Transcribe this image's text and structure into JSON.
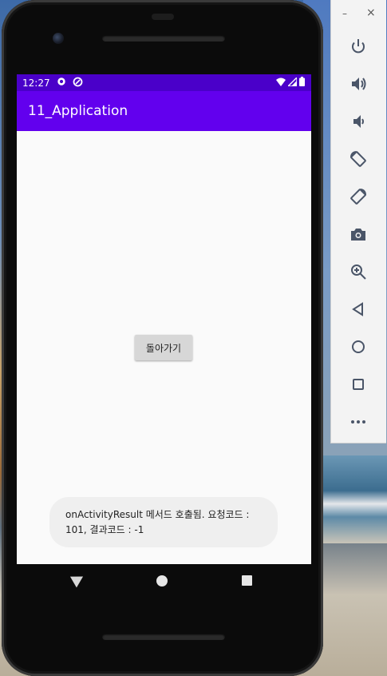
{
  "status_bar": {
    "time": "12:27"
  },
  "app_bar": {
    "title": "11_Application"
  },
  "main": {
    "back_button_label": "돌아가기"
  },
  "toast": {
    "message": "onActivityResult 메서드 호출됨. 요청코드 : 101, 결과코드 : -1"
  },
  "emulator_toolbar": {
    "minimize": "–",
    "close": "×",
    "buttons": [
      "power-icon",
      "volume-up-icon",
      "volume-down-icon",
      "rotate-left-icon",
      "rotate-right-icon",
      "camera-icon",
      "zoom-icon",
      "back-icon",
      "home-icon",
      "overview-icon",
      "more-icon"
    ]
  },
  "colors": {
    "status_bar": "#4a00c9",
    "app_bar": "#6200ee"
  }
}
